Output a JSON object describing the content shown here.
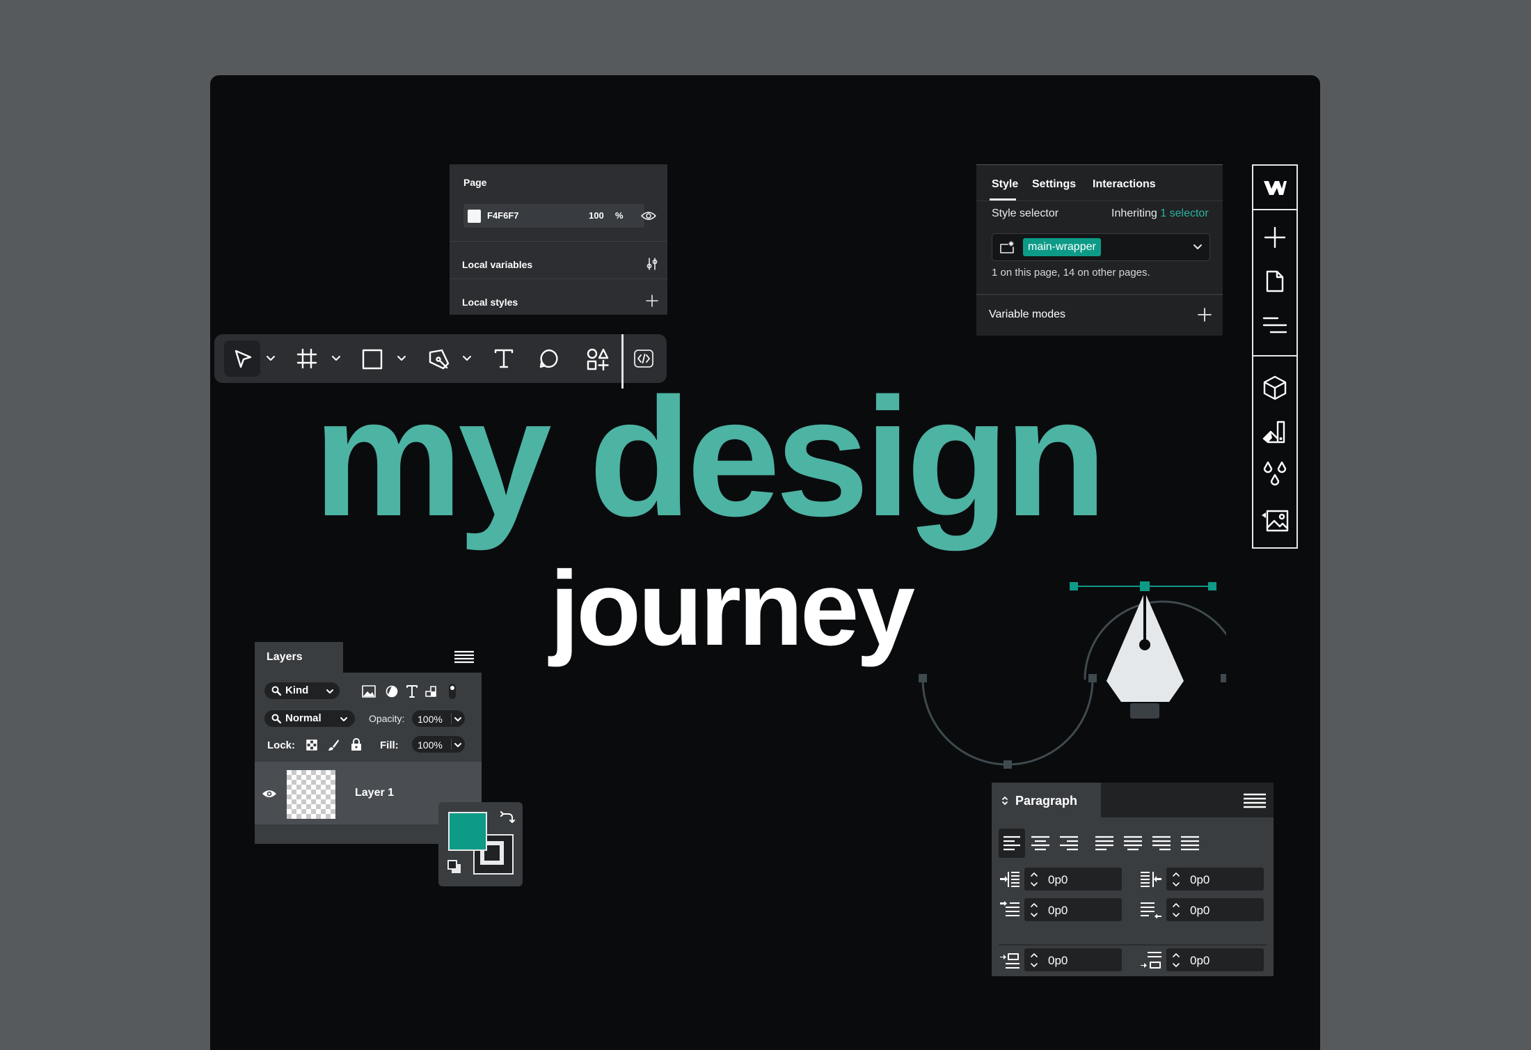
{
  "page_panel": {
    "title": "Page",
    "color_hex": "F4F6F7",
    "opacity": "100",
    "percent": "%",
    "local_variables": "Local variables",
    "local_styles": "Local styles"
  },
  "toolbar": {
    "tools": [
      "move-tool",
      "frame-tool",
      "rectangle-tool",
      "pen-tool",
      "text-tool",
      "comment-tool",
      "actions-tool",
      "dev-mode"
    ],
    "active_tool": "move-tool"
  },
  "style_panel": {
    "tabs": [
      "Style",
      "Settings",
      "Interactions"
    ],
    "active_tab": "Style",
    "style_selector_label": "Style selector",
    "inheriting_label": "Inheriting",
    "inheriting_count": "1 selector",
    "selector_chip": "main-wrapper",
    "usage_info": "1 on this page, 14 on other pages.",
    "variable_modes": "Variable modes"
  },
  "sidebar": {
    "icons": [
      "webflow-logo-icon",
      "add-icon",
      "page-icon",
      "navigator-icon",
      "components-icon",
      "style-manager-icon",
      "variables-icon",
      "assets-icon"
    ]
  },
  "headline": {
    "line1": "my design",
    "line2": "journey"
  },
  "layers_panel": {
    "tab": "Layers",
    "filter_kind": "Kind",
    "blend_mode": "Normal",
    "opacity_label": "Opacity:",
    "opacity_value": "100%",
    "lock_label": "Lock:",
    "fill_label": "Fill:",
    "fill_value": "100%",
    "layers": [
      {
        "name": "Layer 1",
        "visible": true
      }
    ]
  },
  "paragraph_panel": {
    "tab": "Paragraph",
    "fields": [
      "0p0",
      "0p0",
      "0p0",
      "0p0",
      "0p0",
      "0p0"
    ]
  },
  "colors": {
    "accent_teal": "#4db3a3",
    "swatch_teal": "#0d9b88",
    "canvas": "#0a0b0d",
    "backdrop": "#565a5d"
  }
}
